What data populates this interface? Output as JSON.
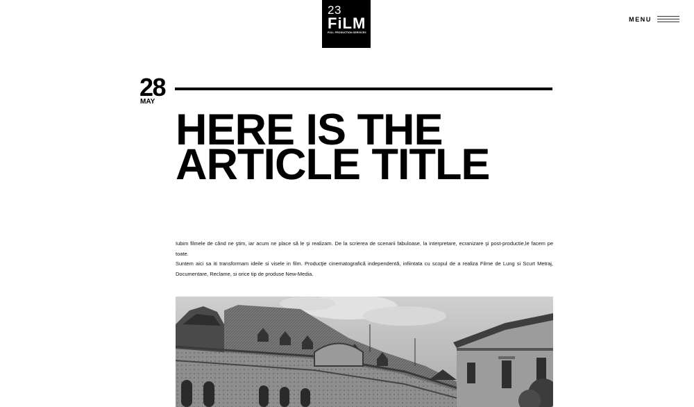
{
  "logo": {
    "number": "23",
    "word": "FiLM",
    "tagline": "FULL PRODUCTION SERVICES"
  },
  "menu": {
    "label": "MENU",
    "icon": "hamburger-icon"
  },
  "article": {
    "date_day": "28",
    "date_month": "MAY",
    "title_lines": [
      "HERE IS THE",
      "ARTICLE TITLE"
    ],
    "body_line_1": "Iubim filmele de când ne ştim, iar acum ne place să le şi realizam. De la scrierea de scenarii fabuloase, la interpretare, ecranizare şi post-productie,le facem pe toate.",
    "body_line_2": "Suntem aici sa iti transformam ideile si visele in film. Producţie cinematografică independentă, infiintata cu scopul de a realiza Filme de Lung si Scurt Metraj, Documentare, Reclame, si orice tip de produse  New-Media.",
    "image": "black-and-white-historic-building-photo"
  },
  "colors": {
    "background": "#ffffff",
    "text": "#000000",
    "logo_background": "#000000"
  }
}
